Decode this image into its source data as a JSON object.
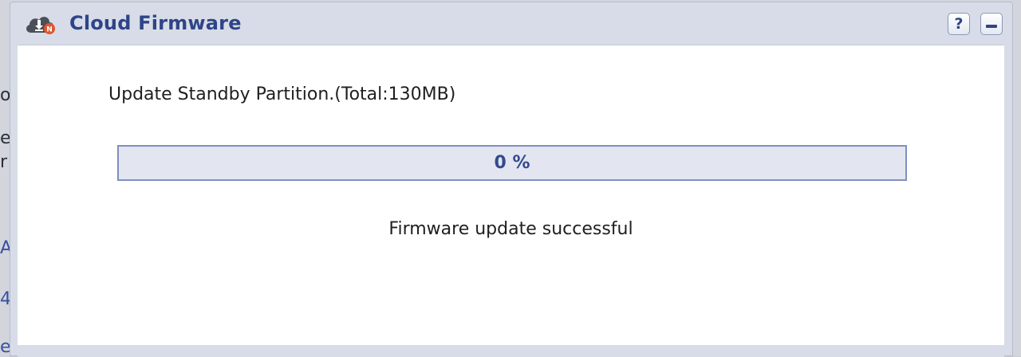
{
  "background": {
    "fragments": [
      {
        "text": "ov",
        "top": 0
      },
      {
        "text": "e",
        "top": 0
      },
      {
        "text": "r",
        "top": 0
      },
      {
        "text": "A",
        "top": 0
      },
      {
        "text": "4",
        "top": 0
      },
      {
        "text": "e",
        "top": 0
      }
    ]
  },
  "dialog": {
    "title": "Cloud Firmware",
    "icon": "cloud-download-icon",
    "help_label": "?",
    "help_icon": "help-icon",
    "minimize_icon": "minimize-icon"
  },
  "content": {
    "partition_label": "Update Standby Partition.(Total:130MB)",
    "progress": {
      "value": 0,
      "text": "0 %"
    },
    "status": "Firmware update successful"
  },
  "colors": {
    "accent": "#2f4487",
    "progress_border": "#7f8fbf",
    "progress_bg": "#e3e6f1"
  }
}
